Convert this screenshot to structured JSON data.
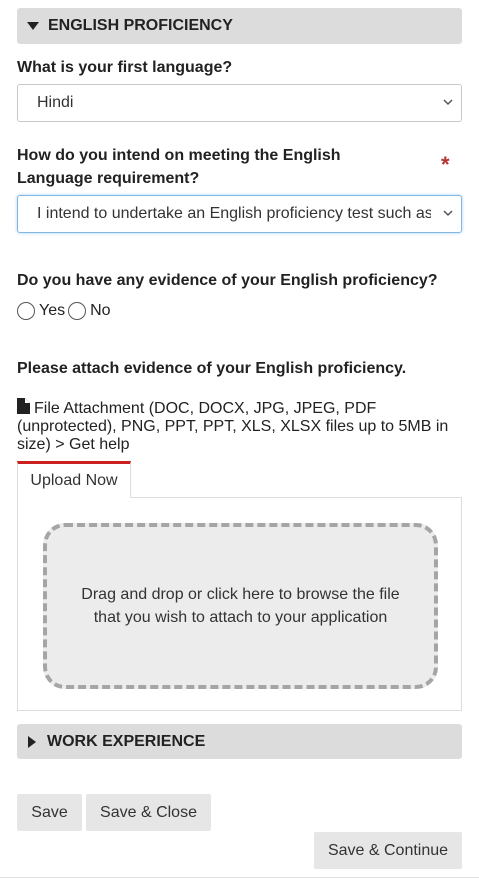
{
  "english_section": {
    "title": "ENGLISH PROFICIENCY",
    "first_language_label": "What is your first language?",
    "first_language_value": "Hindi",
    "meeting_label": "How do you intend on meeting the English Language requirement?",
    "required_mark": "*",
    "meeting_value": "I intend to undertake an English proficiency test such as IELTS",
    "evidence_question": "Do you have any evidence of your English proficiency?",
    "yes_label": "Yes",
    "no_label": "No",
    "attach_label": "Please attach evidence of your English proficiency.",
    "file_attachment_text": "File Attachment (DOC, DOCX, JPG, JPEG, PDF (unprotected), PNG, PPT, PPT, XLS, XLSX files up to 5MB in size) > Get help",
    "upload_tab_label": "Upload Now",
    "dropzone_text": "Drag and drop or click here to browse the file that you wish to attach to your application"
  },
  "work_section": {
    "title": "WORK EXPERIENCE"
  },
  "actions": {
    "save_label": "Save",
    "save_close_label": "Save & Close",
    "save_continue_label": "Save & Continue"
  },
  "colors": {
    "header_bg": "#dcdcdc",
    "required_red": "#b8322f",
    "tab_accent": "#cc1f1f",
    "focus_border": "#7fb8e6"
  },
  "icons": {
    "collapse": "triangle-down-icon",
    "expand": "triangle-right-icon",
    "dropdown": "chevron-down-icon",
    "file": "file-icon"
  }
}
